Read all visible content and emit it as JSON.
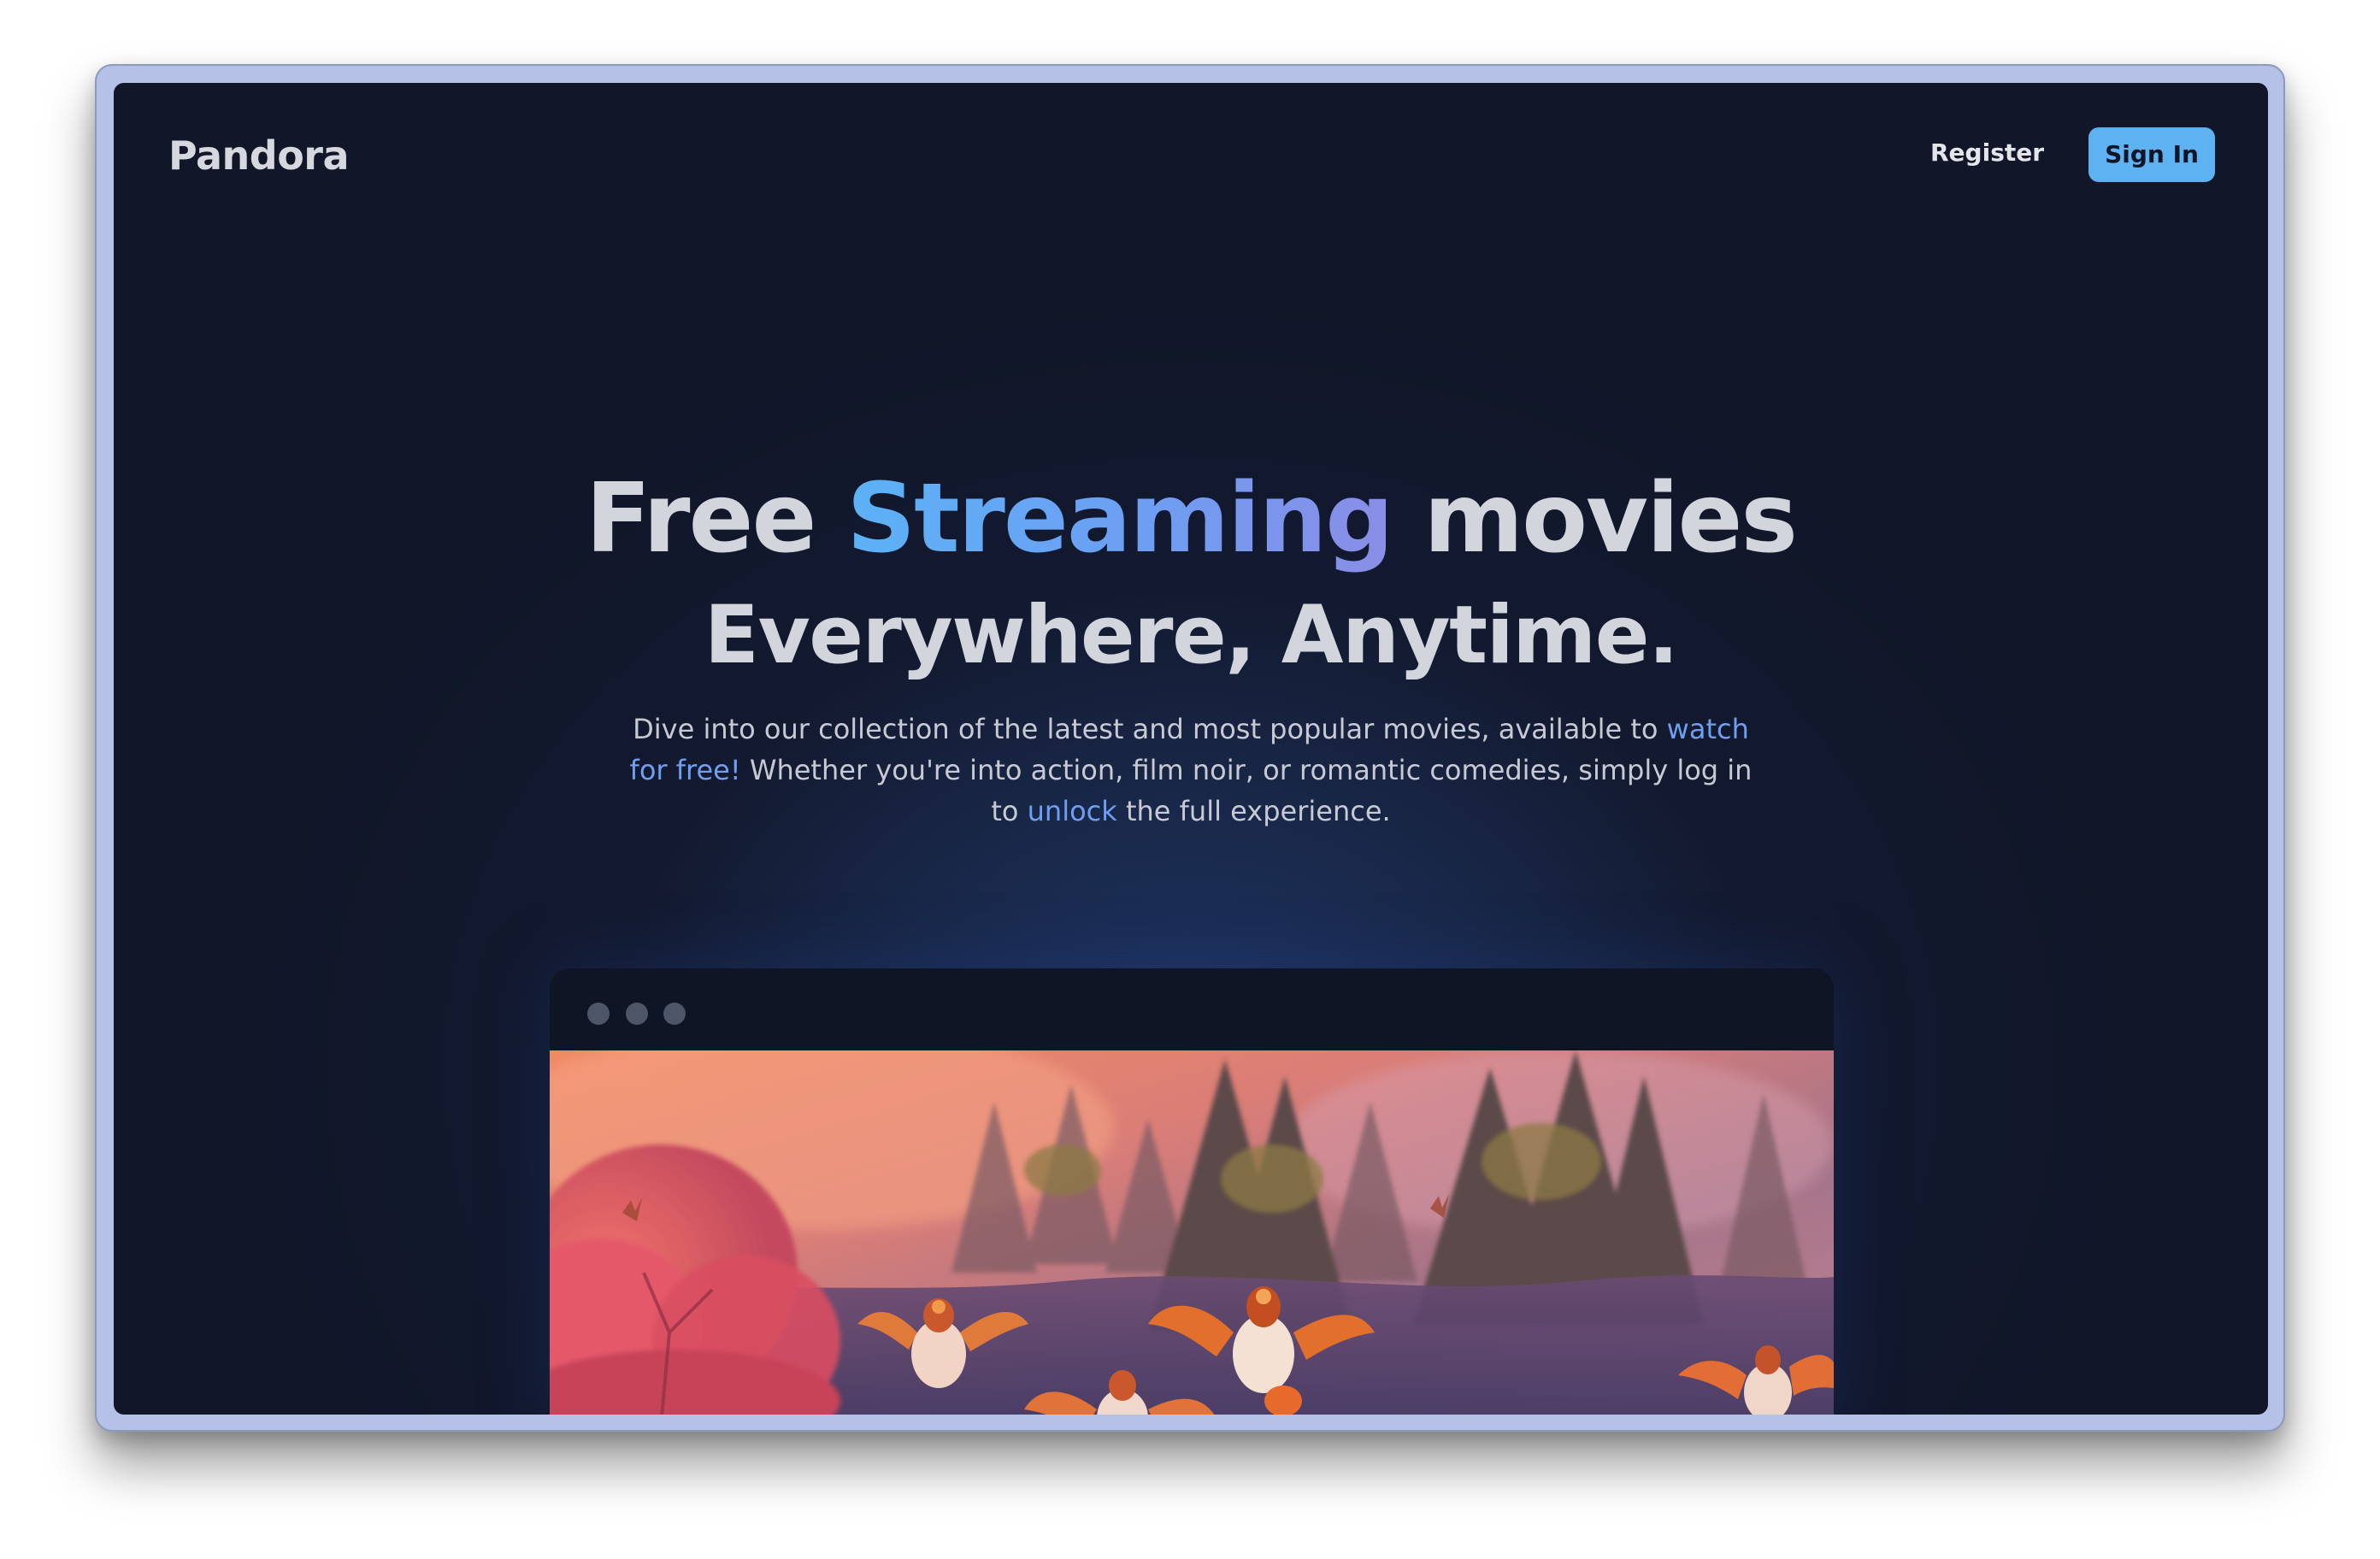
{
  "brand": {
    "name": "Pandora"
  },
  "nav": {
    "register_label": "Register",
    "signin_label": "Sign In"
  },
  "hero": {
    "title_part1": "Free ",
    "title_accent": "Streaming",
    "title_part2": " movies",
    "subtitle": "Everywhere, Anytime.",
    "desc_part1": "Dive into our collection of the latest and most popular movies, available to ",
    "desc_link1": "watch for free!",
    "desc_part2": " Whether you're into action, film noir, or romantic comedies, simply log in to ",
    "desc_link2": "unlock",
    "desc_part3": " the full experience."
  },
  "preview": {
    "window_dots": [
      "window-dot-icon",
      "window-dot-icon",
      "window-dot-icon"
    ],
    "image_subject": "animated forest scene with flying orange birds"
  },
  "colors": {
    "background": "#131a30",
    "accent_gradient_start": "#5cb2f6",
    "accent_gradient_end": "#8b8de6",
    "signin_button": "#5db3f1",
    "link": "#6f9ff2",
    "frame": "#b5c1e6"
  }
}
